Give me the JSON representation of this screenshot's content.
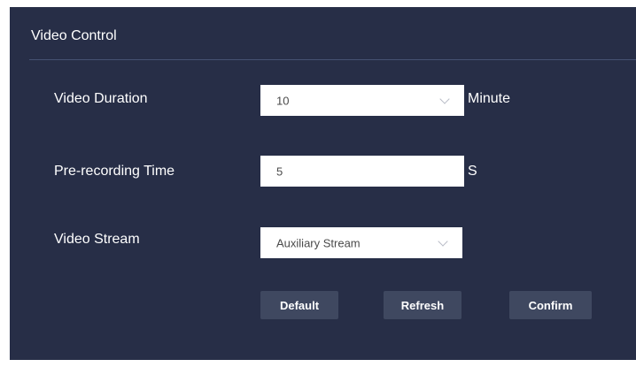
{
  "panel": {
    "title": "Video Control"
  },
  "fields": {
    "duration": {
      "label": "Video Duration",
      "value": "10",
      "unit": "Minute"
    },
    "prerecord": {
      "label": "Pre-recording Time",
      "value": "5",
      "unit": "S"
    },
    "stream": {
      "label": "Video Stream",
      "value": "Auxiliary Stream"
    }
  },
  "buttons": {
    "default_label": "Default",
    "refresh_label": "Refresh",
    "confirm_label": "Confirm"
  },
  "icons": {
    "dropdown": "chevron-down-icon"
  },
  "colors": {
    "panel_background": "#272e47",
    "button_background": "#3f4860",
    "text": "#ffffff"
  }
}
